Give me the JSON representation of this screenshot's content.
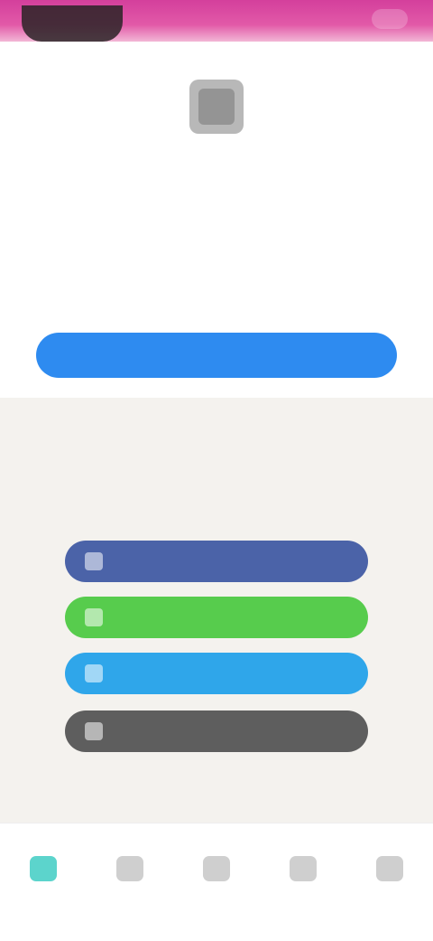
{
  "colors": {
    "accent": "#2e8bf0",
    "brand": "#d43f9c",
    "facebook": "#4b63a8",
    "wechat": "#57cc4d",
    "twitter": "#2fa6ea",
    "github": "#5e5e5e",
    "tab_active": "#5cd4cc"
  },
  "header": {
    "back_icon": "back-icon",
    "menu_icon": "more-icon"
  },
  "profile": {
    "logo_icon": "app-logo-icon",
    "title": "",
    "subtitle": "",
    "note": ""
  },
  "primary_button": {
    "label": ""
  },
  "helper": {
    "text": "",
    "link_text": ""
  },
  "alternatives": {
    "title": "",
    "subtitle": ""
  },
  "social_buttons": [
    {
      "icon": "facebook-icon",
      "label": ""
    },
    {
      "icon": "wechat-icon",
      "label": ""
    },
    {
      "icon": "twitter-icon",
      "label": ""
    },
    {
      "icon": "github-icon",
      "label": ""
    }
  ],
  "tabs": [
    {
      "icon": "home-icon",
      "label": "",
      "active": true
    },
    {
      "icon": "discover-icon",
      "label": "",
      "active": false
    },
    {
      "icon": "add-icon",
      "label": "",
      "active": false
    },
    {
      "icon": "message-icon",
      "label": "",
      "active": false
    },
    {
      "icon": "profile-icon",
      "label": "",
      "active": false
    }
  ]
}
